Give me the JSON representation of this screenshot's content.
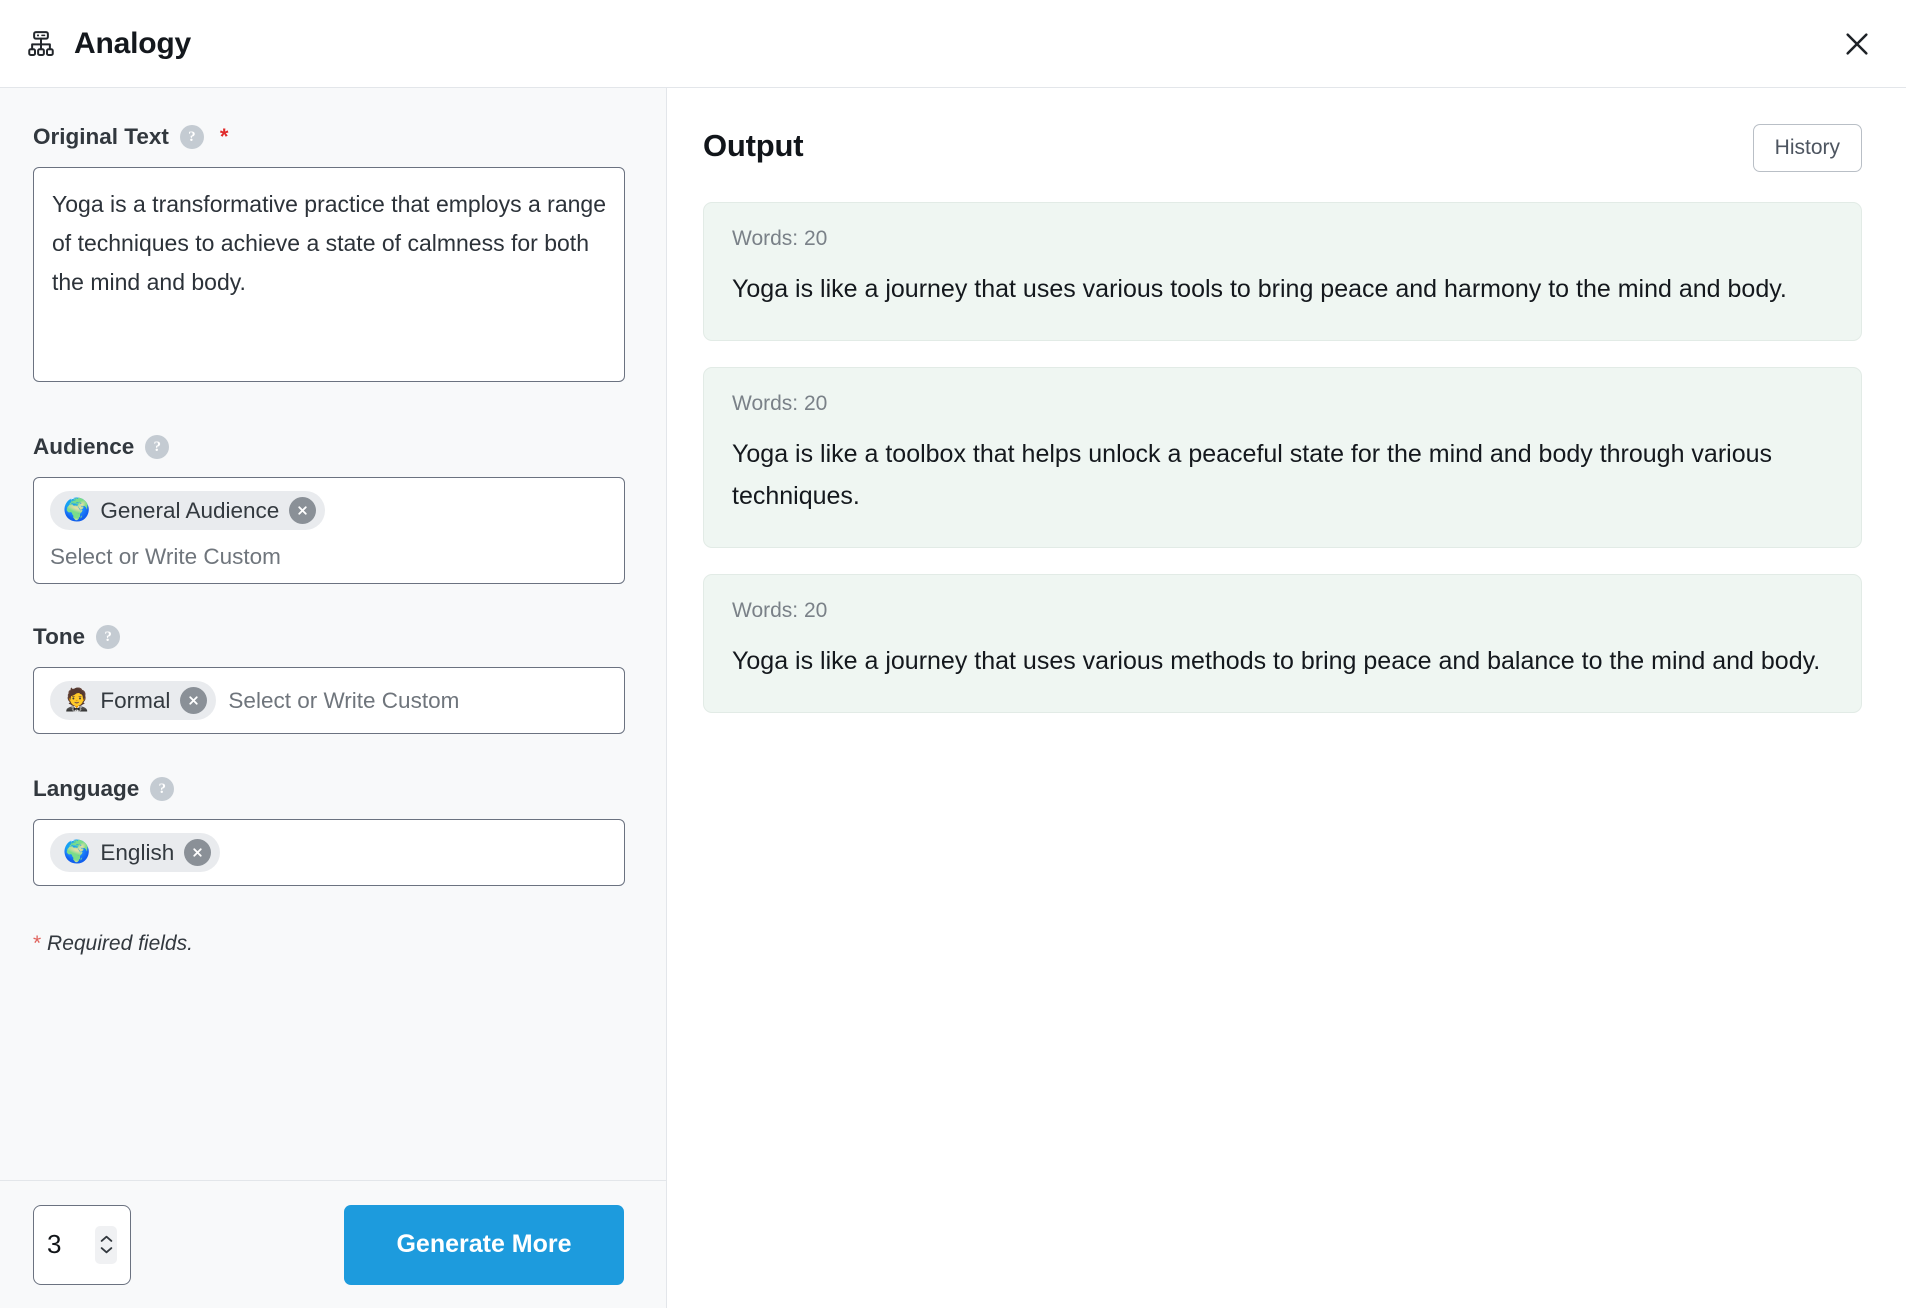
{
  "window": {
    "title": "Analogy",
    "icon": "sitemap-icon",
    "close_icon": "close-icon"
  },
  "left_panel": {
    "original_text": {
      "label": "Original Text",
      "help_icon": "question-mark-icon",
      "required_marker": "*",
      "value": "Yoga is a transformative practice that employs a range of techniques to achieve a state of calmness for both the mind and body."
    },
    "audience": {
      "label": "Audience",
      "help_icon": "question-mark-icon",
      "tags": [
        {
          "emoji": "🌍",
          "emoji_name": "globe-icon",
          "label": "General Audience",
          "remove_icon": "remove-tag-icon"
        }
      ],
      "placeholder": "Select or Write Custom"
    },
    "tone": {
      "label": "Tone",
      "help_icon": "question-mark-icon",
      "tags": [
        {
          "emoji": "🤵",
          "emoji_name": "person-in-tuxedo-icon",
          "label": "Formal",
          "remove_icon": "remove-tag-icon"
        }
      ],
      "placeholder": "Select or Write Custom"
    },
    "language": {
      "label": "Language",
      "help_icon": "question-mark-icon",
      "tags": [
        {
          "emoji": "🌍",
          "emoji_name": "globe-icon",
          "label": "English",
          "remove_icon": "remove-tag-icon"
        }
      ]
    },
    "required_note": {
      "star": "*",
      "text": "Required fields."
    },
    "footer": {
      "count_value": "3",
      "stepper_up_icon": "chevron-up-icon",
      "stepper_down_icon": "chevron-down-icon",
      "generate_label": "Generate More"
    }
  },
  "right_panel": {
    "title": "Output",
    "history_label": "History",
    "results": [
      {
        "words_label": "Words: 20",
        "text": "Yoga is like a journey that uses various tools to bring peace and harmony to the mind and body."
      },
      {
        "words_label": "Words: 20",
        "text": "Yoga is like a toolbox that helps unlock a peaceful state for the mind and body through various techniques."
      },
      {
        "words_label": "Words: 20",
        "text": "Yoga is like a journey that uses various methods to bring peace and balance to the mind and body."
      }
    ]
  },
  "colors": {
    "accent": "#1d9bdd",
    "panel_bg": "#f8f9fa",
    "card_bg": "#eff6f2",
    "required": "#e02b2b"
  }
}
